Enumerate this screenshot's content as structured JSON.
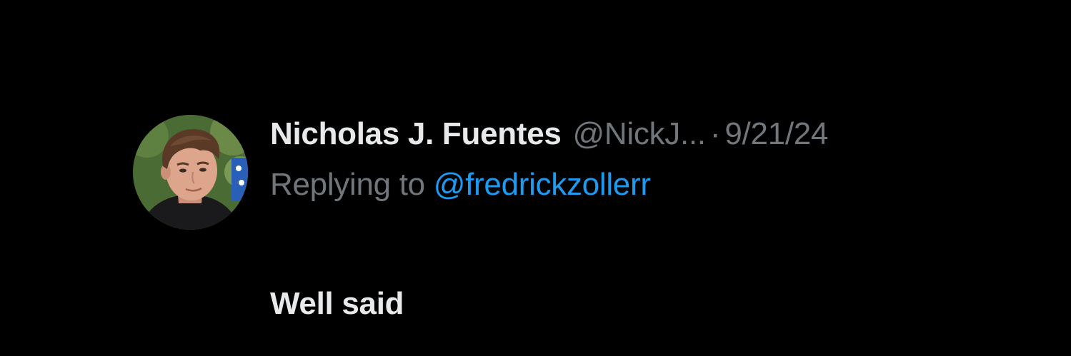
{
  "tweet": {
    "display_name": "Nicholas J. Fuentes",
    "handle": "@NickJ...",
    "separator": "·",
    "date": "9/21/24",
    "reply_prefix": "Replying to ",
    "reply_handle": "@fredrickzollerr",
    "text": "Well said",
    "avatar_icon": "profile-photo"
  },
  "colors": {
    "background": "#000000",
    "primary_text": "#e7e9ea",
    "secondary_text": "#71767b",
    "link": "#1d9bf0"
  }
}
